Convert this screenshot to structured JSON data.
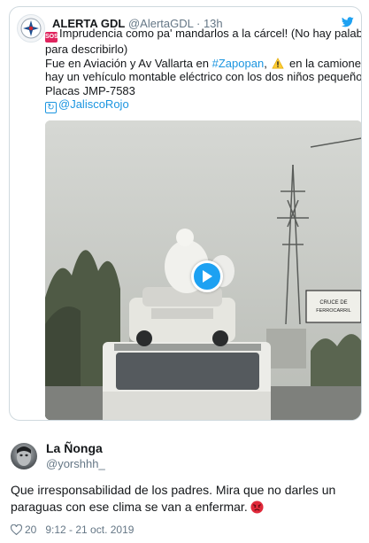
{
  "quoted_tweet": {
    "name": "ALERTA GDL",
    "handle": "@AlertaGDL",
    "separator": "·",
    "time": "13h",
    "text_line1": "Imprudencia como pa' mandarlos a la cárcel! (No hay palabras",
    "text_line2": "para describirlo)",
    "text_line3_before": "Fue en Aviación y Av Vallarta en ",
    "hashtag": "#Zapopan",
    "text_line3_mid": ", ",
    "text_line3_after": " en la camioneta",
    "text_line4": "hay un vehículo montable eléctrico con los dos niños pequeños.",
    "text_line5": "Placas JMP-7583",
    "mention": "@JaliscoRojo",
    "sos_label": "SOS",
    "icons": {
      "bird": "twitter-bird-icon",
      "warning": "warning-icon",
      "retweet": "retweet-icon",
      "play": "play-icon"
    },
    "video_sign_lines": [
      "CRUCE DE",
      "FERROCARRIL"
    ]
  },
  "reply": {
    "name": "La Ñonga",
    "handle": "@yorshhh_",
    "text_line1": "Que irresponsabilidad de los padres. Mira que no darles un",
    "text_line2": "paraguas con ese clima se van a enfermar.",
    "likes": "20",
    "timestamp": "9:12 - 21 oct. 2019"
  },
  "colors": {
    "link": "#1b95e0",
    "play": "#1da1f2",
    "secondary_text": "#657786",
    "border": "#cfd9de"
  }
}
